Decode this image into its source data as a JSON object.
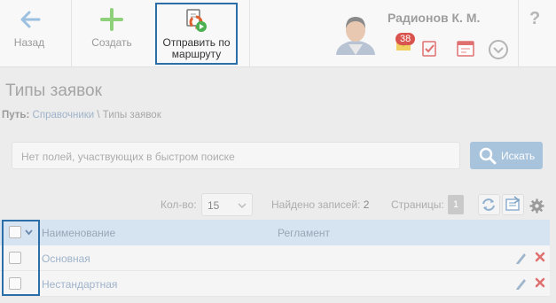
{
  "toolbar": {
    "back_label": "Назад",
    "create_label": "Создать",
    "route_label_line1": "Отправить по",
    "route_label_line2": "маршруту"
  },
  "user": {
    "name": "Радионов К. М.",
    "mail_count": "38"
  },
  "help_label": "?",
  "page": {
    "title": "Типы заявок",
    "breadcrumb_prefix": "Путь:",
    "breadcrumb_link": "Справочники",
    "breadcrumb_current": " \\ Типы заявок"
  },
  "search": {
    "placeholder": "Нет полей, участвующих в быстром поиске",
    "button_label": "Искать"
  },
  "pager": {
    "count_label": "Кол-во:",
    "count_value": "15",
    "found_label": "Найдено записей:",
    "found_value": "2",
    "pages_label": "Страницы:",
    "page_current": "1"
  },
  "table": {
    "columns": [
      "Наименование",
      "Регламент"
    ],
    "rows": [
      {
        "name": "Основная",
        "reglament": ""
      },
      {
        "name": "Нестандартная",
        "reglament": ""
      }
    ]
  },
  "colors": {
    "accent": "#2c6fa8",
    "link": "#9fb3ca",
    "badge": "#d9534f",
    "create_icon": "#8fd07a",
    "back_icon": "#9cc0e0"
  },
  "icons": [
    "arrow-left-icon",
    "plus-icon",
    "route-document-icon",
    "mail-icon",
    "check-icon",
    "calendar-icon",
    "chevron-down-icon",
    "search-icon",
    "refresh-icon",
    "export-icon",
    "gear-icon",
    "pencil-icon",
    "close-icon"
  ]
}
